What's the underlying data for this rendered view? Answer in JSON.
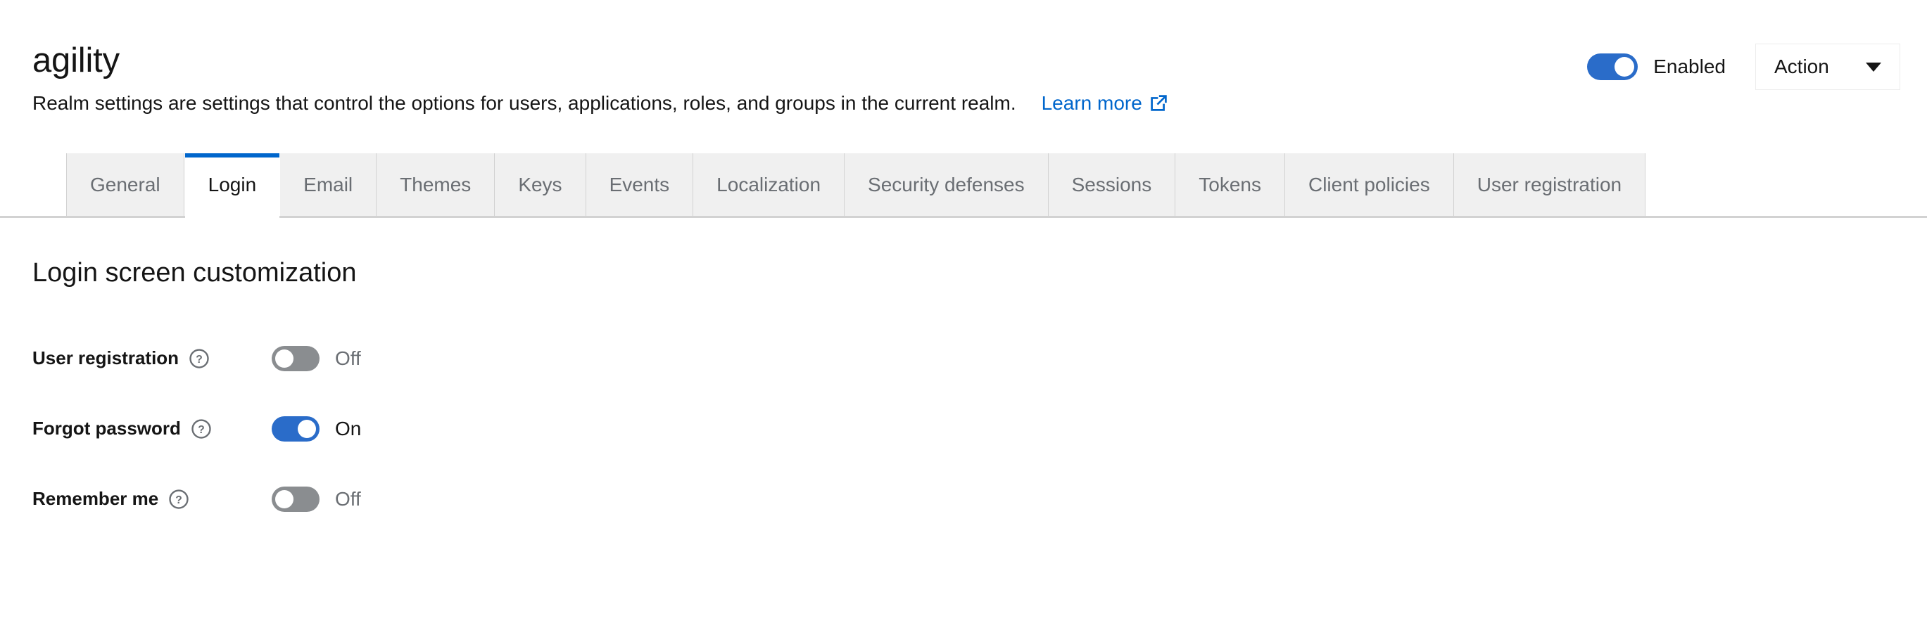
{
  "header": {
    "title": "agility",
    "description": "Realm settings are settings that control the options for users, applications, roles, and groups in the current realm.",
    "learn_more_label": "Learn more",
    "learn_more_icon": "external-link-icon",
    "enabled_label": "Enabled",
    "enabled_state": "on",
    "action_label": "Action",
    "action_caret_icon": "caret-down-icon"
  },
  "tabs": [
    {
      "label": "General",
      "active": false
    },
    {
      "label": "Login",
      "active": true
    },
    {
      "label": "Email",
      "active": false
    },
    {
      "label": "Themes",
      "active": false
    },
    {
      "label": "Keys",
      "active": false
    },
    {
      "label": "Events",
      "active": false
    },
    {
      "label": "Localization",
      "active": false
    },
    {
      "label": "Security defenses",
      "active": false
    },
    {
      "label": "Sessions",
      "active": false
    },
    {
      "label": "Tokens",
      "active": false
    },
    {
      "label": "Client policies",
      "active": false
    },
    {
      "label": "User registration",
      "active": false
    }
  ],
  "main": {
    "section_title": "Login screen customization",
    "rows": [
      {
        "label": "User registration",
        "help_icon": "help-circle-icon",
        "state": "Off",
        "on": false
      },
      {
        "label": "Forgot password",
        "help_icon": "help-circle-icon",
        "state": "On",
        "on": true
      },
      {
        "label": "Remember me",
        "help_icon": "help-circle-icon",
        "state": "Off",
        "on": false
      }
    ]
  },
  "colors": {
    "accent_blue": "#0066cc",
    "switch_on": "#2a6cc9",
    "switch_off": "#8a8d90",
    "tab_inactive_bg": "#f0f0f0",
    "text_primary": "#151515",
    "text_muted": "#6a6e73",
    "border": "#d2d2d2"
  }
}
